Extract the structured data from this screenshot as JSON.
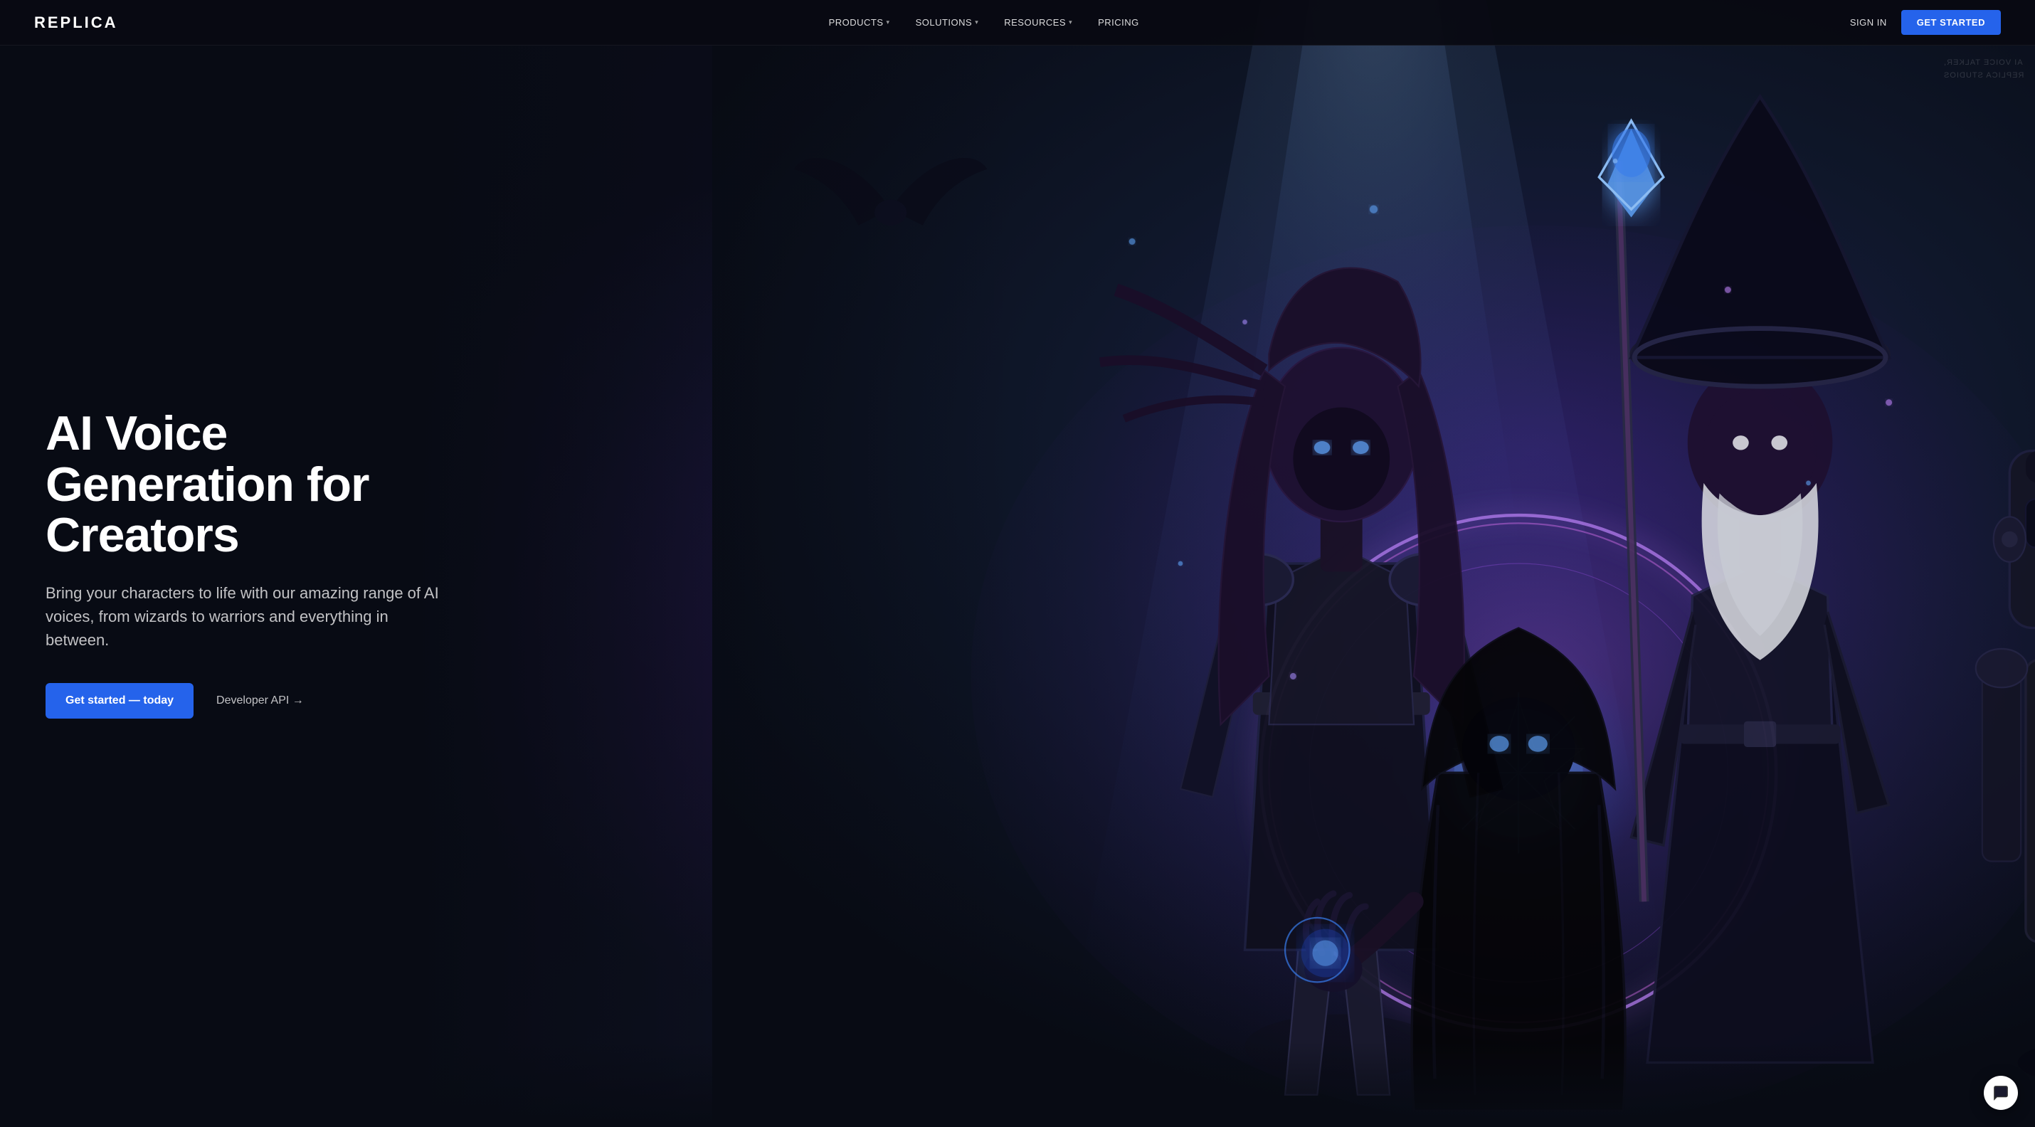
{
  "brand": {
    "name": "REPLICA"
  },
  "nav": {
    "links": [
      {
        "label": "PRODUCTS",
        "has_dropdown": true
      },
      {
        "label": "SOLUTIONS",
        "has_dropdown": true
      },
      {
        "label": "RESOURCES",
        "has_dropdown": true
      },
      {
        "label": "PRICING",
        "has_dropdown": false
      }
    ],
    "sign_in": "SIGN IN",
    "get_started": "GET STARTED"
  },
  "hero": {
    "title": "AI Voice Generation for Creators",
    "subtitle": "Bring your characters to life with our amazing range of AI voices, from wizards to warriors and everything in between.",
    "cta_primary": "Get started — today",
    "cta_secondary": "Developer API →",
    "watermark_line1": "AI VOICE TALKER,",
    "watermark_line2": "REPLICA STUDIOS"
  },
  "chat": {
    "label": "Chat"
  },
  "colors": {
    "accent_blue": "#2563eb",
    "bg_dark": "#080b14",
    "text_primary": "#ffffff",
    "text_muted": "rgba(255,255,255,0.75)"
  }
}
